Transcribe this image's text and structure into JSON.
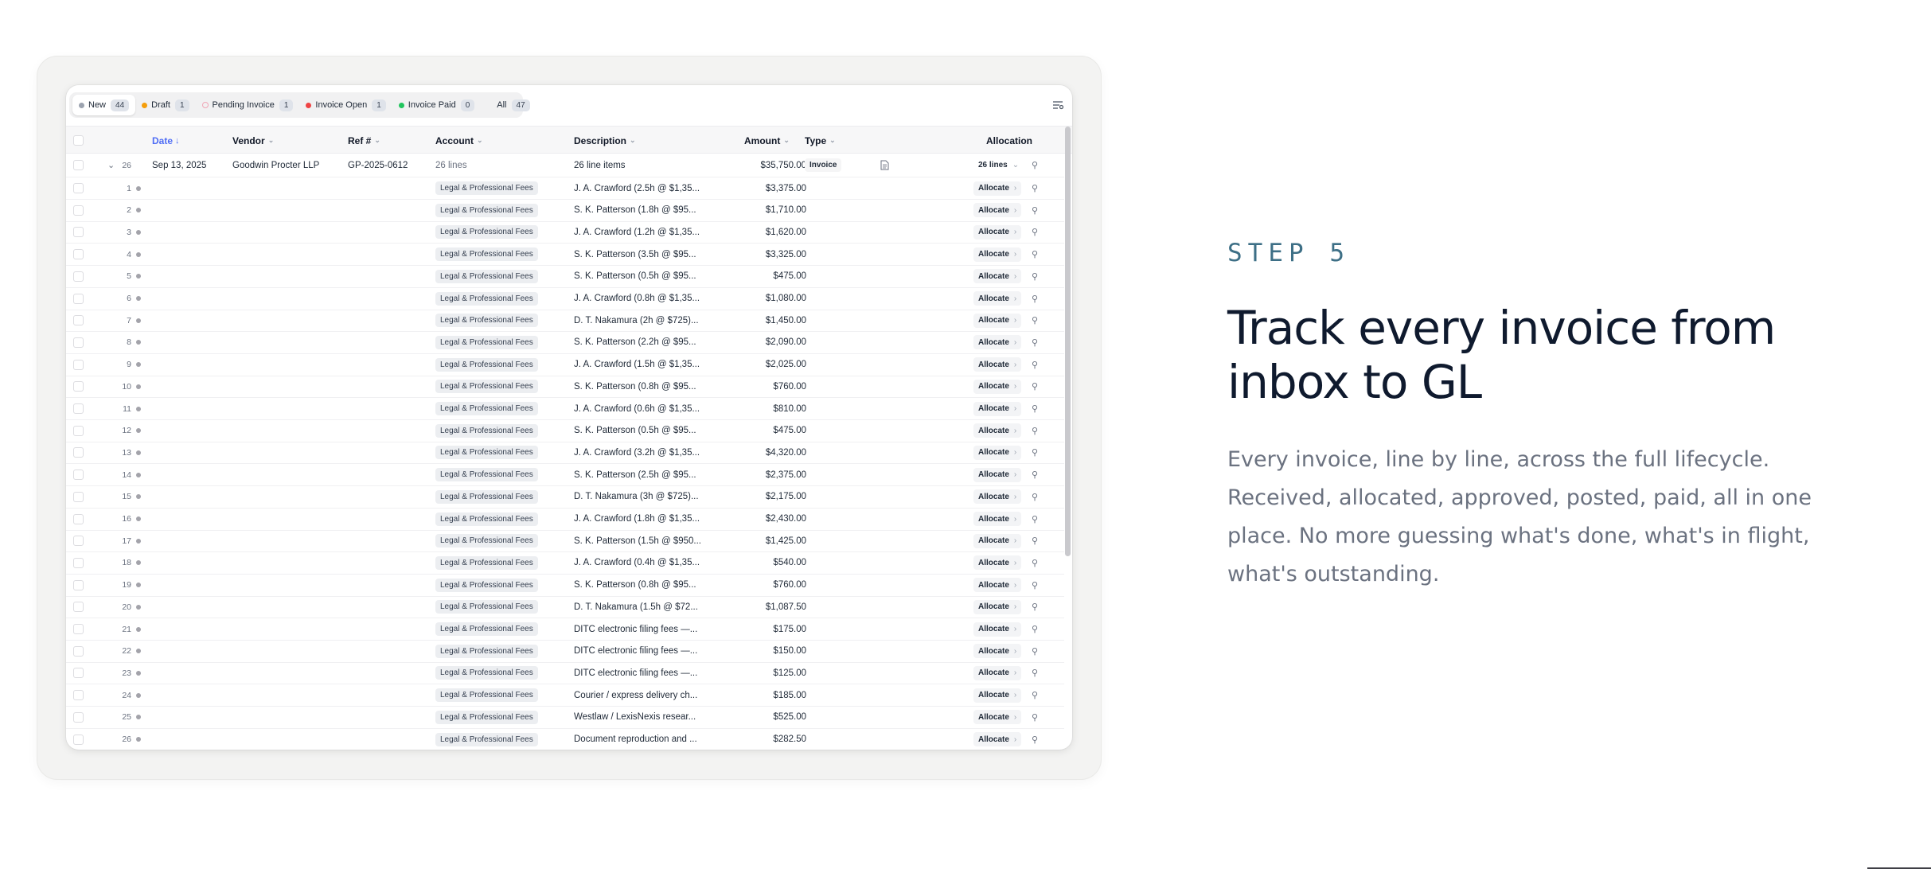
{
  "tabs": [
    {
      "label": "New",
      "count": "44",
      "color": "#9ca3af",
      "active": true
    },
    {
      "label": "Draft",
      "count": "1",
      "color": "#f59e0b"
    },
    {
      "label": "Pending Invoice",
      "count": "1",
      "color": "#f0a5b5",
      "ring": true
    },
    {
      "label": "Invoice Open",
      "count": "1",
      "color": "#ef4444"
    },
    {
      "label": "Invoice Paid",
      "count": "0",
      "color": "#22c55e"
    },
    {
      "label": "All",
      "count": "47"
    }
  ],
  "columns": {
    "date": "Date",
    "vendor": "Vendor",
    "ref": "Ref #",
    "account": "Account",
    "description": "Description",
    "amount": "Amount",
    "type": "Type",
    "allocation": "Allocation"
  },
  "parent_row": {
    "count": "26",
    "date": "Sep 13, 2025",
    "vendor": "Goodwin Procter LLP",
    "ref": "GP-2025-0612",
    "account": "26 lines",
    "description": "26 line items",
    "amount": "$35,750.00",
    "type": "Invoice",
    "allocation": "26 lines"
  },
  "account_label": "Legal & Professional Fees",
  "allocate_label": "Allocate",
  "lines": [
    {
      "n": "1",
      "desc": "J. A. Crawford (2.5h @ $1,35...",
      "amount": "$3,375.00"
    },
    {
      "n": "2",
      "desc": "S. K. Patterson (1.8h @ $95...",
      "amount": "$1,710.00"
    },
    {
      "n": "3",
      "desc": "J. A. Crawford (1.2h @ $1,35...",
      "amount": "$1,620.00"
    },
    {
      "n": "4",
      "desc": "S. K. Patterson (3.5h @ $95...",
      "amount": "$3,325.00"
    },
    {
      "n": "5",
      "desc": "S. K. Patterson (0.5h @ $95...",
      "amount": "$475.00"
    },
    {
      "n": "6",
      "desc": "J. A. Crawford (0.8h @ $1,35...",
      "amount": "$1,080.00"
    },
    {
      "n": "7",
      "desc": "D. T. Nakamura (2h @ $725)...",
      "amount": "$1,450.00"
    },
    {
      "n": "8",
      "desc": "S. K. Patterson (2.2h @ $95...",
      "amount": "$2,090.00"
    },
    {
      "n": "9",
      "desc": "J. A. Crawford (1.5h @ $1,35...",
      "amount": "$2,025.00"
    },
    {
      "n": "10",
      "desc": "S. K. Patterson (0.8h @ $95...",
      "amount": "$760.00"
    },
    {
      "n": "11",
      "desc": "J. A. Crawford (0.6h @ $1,35...",
      "amount": "$810.00"
    },
    {
      "n": "12",
      "desc": "S. K. Patterson (0.5h @ $95...",
      "amount": "$475.00"
    },
    {
      "n": "13",
      "desc": "J. A. Crawford (3.2h @ $1,35...",
      "amount": "$4,320.00"
    },
    {
      "n": "14",
      "desc": "S. K. Patterson (2.5h @ $95...",
      "amount": "$2,375.00"
    },
    {
      "n": "15",
      "desc": "D. T. Nakamura (3h @ $725)...",
      "amount": "$2,175.00"
    },
    {
      "n": "16",
      "desc": "J. A. Crawford (1.8h @ $1,35...",
      "amount": "$2,430.00"
    },
    {
      "n": "17",
      "desc": "S. K. Patterson (1.5h @ $950...",
      "amount": "$1,425.00"
    },
    {
      "n": "18",
      "desc": "J. A. Crawford (0.4h @ $1,35...",
      "amount": "$540.00"
    },
    {
      "n": "19",
      "desc": "S. K. Patterson (0.8h @ $95...",
      "amount": "$760.00"
    },
    {
      "n": "20",
      "desc": "D. T. Nakamura (1.5h @ $72...",
      "amount": "$1,087.50"
    },
    {
      "n": "21",
      "desc": "DITC electronic filing fees —...",
      "amount": "$175.00"
    },
    {
      "n": "22",
      "desc": "DITC electronic filing fees —...",
      "amount": "$150.00"
    },
    {
      "n": "23",
      "desc": "DITC electronic filing fees —...",
      "amount": "$125.00"
    },
    {
      "n": "24",
      "desc": "Courier / express delivery ch...",
      "amount": "$185.00"
    },
    {
      "n": "25",
      "desc": "Westlaw / LexisNexis resear...",
      "amount": "$525.00"
    },
    {
      "n": "26",
      "desc": "Document reproduction and ...",
      "amount": "$282.50"
    }
  ],
  "copy": {
    "step": "STEP 5",
    "headline": "Track every invoice from inbox to GL",
    "body": "Every invoice, line by line, across the full lifecycle. Received, allocated, approved, posted, paid, all in one place. No more guessing what's done, what's in flight, what's outstanding."
  },
  "colors": {
    "accent": "#4f6df5",
    "step": "#3d6f86",
    "headline": "#0f1a2e",
    "body": "#6b7280"
  }
}
